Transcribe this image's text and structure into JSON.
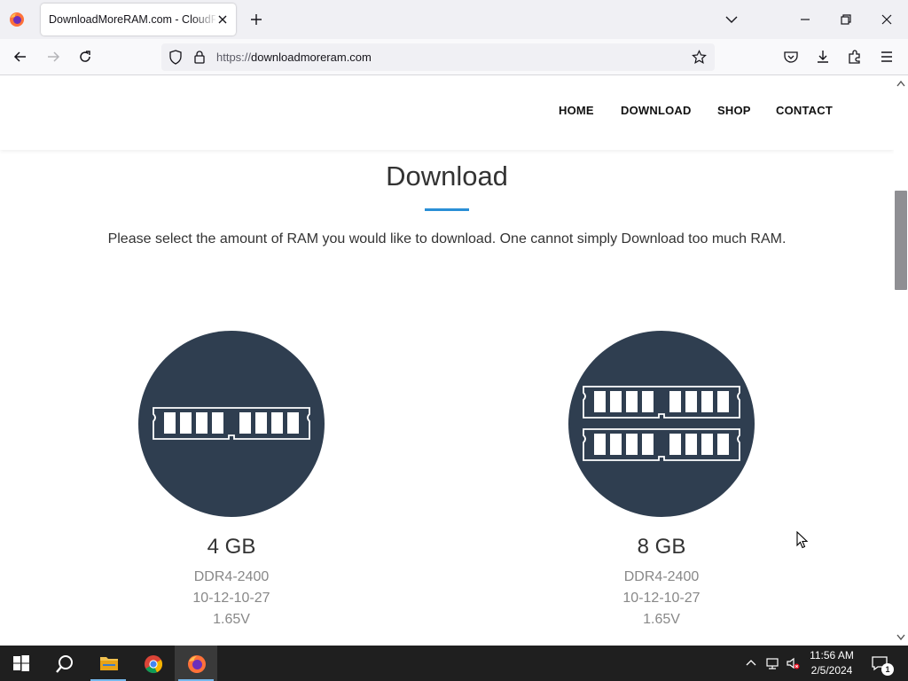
{
  "browser": {
    "tab_title": "DownloadMoreRAM.com - CloudRing",
    "url_protocol": "https://",
    "url_domain": "downloadmoreram.com"
  },
  "site": {
    "nav": [
      "HOME",
      "DOWNLOAD",
      "SHOP",
      "CONTACT"
    ],
    "title": "Download",
    "intro": "Please select the amount of RAM you would like to download. One cannot simply Download too much RAM.",
    "products": [
      {
        "size": "4 GB",
        "type": "DDR4-2400",
        "timings": "10-12-10-27",
        "voltage": "1.65V",
        "icon": "ram-single-icon"
      },
      {
        "size": "8 GB",
        "type": "DDR4-2400",
        "timings": "10-12-10-27",
        "voltage": "1.65V",
        "icon": "ram-double-icon"
      }
    ]
  },
  "taskbar": {
    "time": "11:56 AM",
    "date": "2/5/2024",
    "notification_count": "1"
  },
  "colors": {
    "circle": "#2f3e50",
    "accent": "#2a8fd6",
    "taskbar": "#1f1f1f"
  }
}
